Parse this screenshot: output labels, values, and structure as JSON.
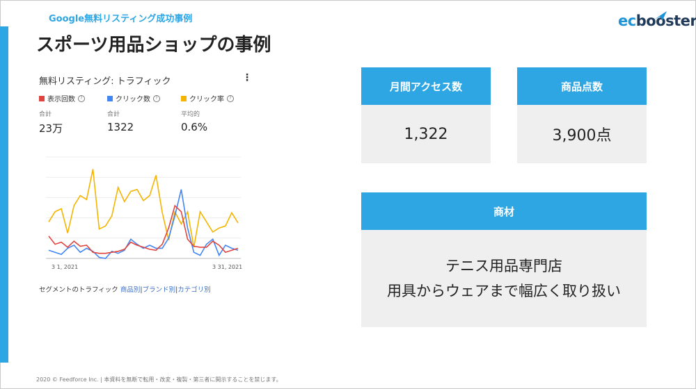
{
  "slide": {
    "subtitle": "Google無料リスティング成功事例",
    "title": "スポーツ用品ショップの事例",
    "footer": "2020 © Feedforce Inc. | 本資料を無断で転用・改変・複製・第三者に開示することを禁じます。"
  },
  "logo": {
    "part1": "ec",
    "part2": "booster"
  },
  "colors": {
    "accent": "#2ea6e3",
    "impressions": "#e0443e",
    "clicks": "#4285f4",
    "ctr": "#f4b400",
    "box_bg": "#efefef"
  },
  "chart_card": {
    "title": "無料リスティング: トラフィック",
    "menu_icon": "more-vertical-icon",
    "metrics": [
      {
        "legend": "表示回数",
        "label": "合計",
        "value": "23万"
      },
      {
        "legend": "クリック数",
        "label": "合計",
        "value": "1322"
      },
      {
        "legend": "クリック率",
        "label": "平均的",
        "value": "0.6%"
      }
    ],
    "segment": {
      "prefix": "セグメントのトラフィック",
      "links": [
        "商品別",
        "ブランド別",
        "カテゴリ別"
      ]
    }
  },
  "chart_data": {
    "type": "line",
    "x_labels": [
      "3 1, 2021",
      "3 31, 2021"
    ],
    "x": [
      1,
      2,
      3,
      4,
      5,
      6,
      7,
      8,
      9,
      10,
      11,
      12,
      13,
      14,
      15,
      16,
      17,
      18,
      19,
      20,
      21,
      22,
      23,
      24,
      25,
      26,
      27,
      28,
      29,
      30,
      31
    ],
    "series": [
      {
        "name": "表示回数",
        "values": [
          22,
          14,
          16,
          11,
          17,
          12,
          13,
          6,
          5,
          5,
          6,
          7,
          9,
          16,
          13,
          11,
          9,
          8,
          14,
          30,
          52,
          46,
          19,
          12,
          11,
          11,
          17,
          13,
          6,
          8,
          10
        ]
      },
      {
        "name": "クリック数",
        "values": [
          8,
          6,
          4,
          10,
          13,
          6,
          10,
          7,
          1,
          0,
          7,
          5,
          8,
          19,
          14,
          10,
          13,
          10,
          10,
          20,
          42,
          68,
          30,
          6,
          3,
          14,
          19,
          3,
          13,
          10,
          8
        ]
      },
      {
        "name": "クリック率",
        "values": [
          36,
          46,
          49,
          25,
          52,
          62,
          58,
          88,
          29,
          32,
          42,
          70,
          56,
          66,
          68,
          57,
          62,
          82,
          45,
          18,
          46,
          34,
          46,
          11,
          46,
          36,
          26,
          30,
          32,
          45,
          35
        ]
      }
    ]
  },
  "stats": [
    {
      "header": "月間アクセス数",
      "value": "1,322"
    },
    {
      "header": "商品点数",
      "value": "3,900点"
    }
  ],
  "material": {
    "header": "商材",
    "line1": "テニス用品専門店",
    "line2": "用具からウェアまで幅広く取り扱い"
  }
}
